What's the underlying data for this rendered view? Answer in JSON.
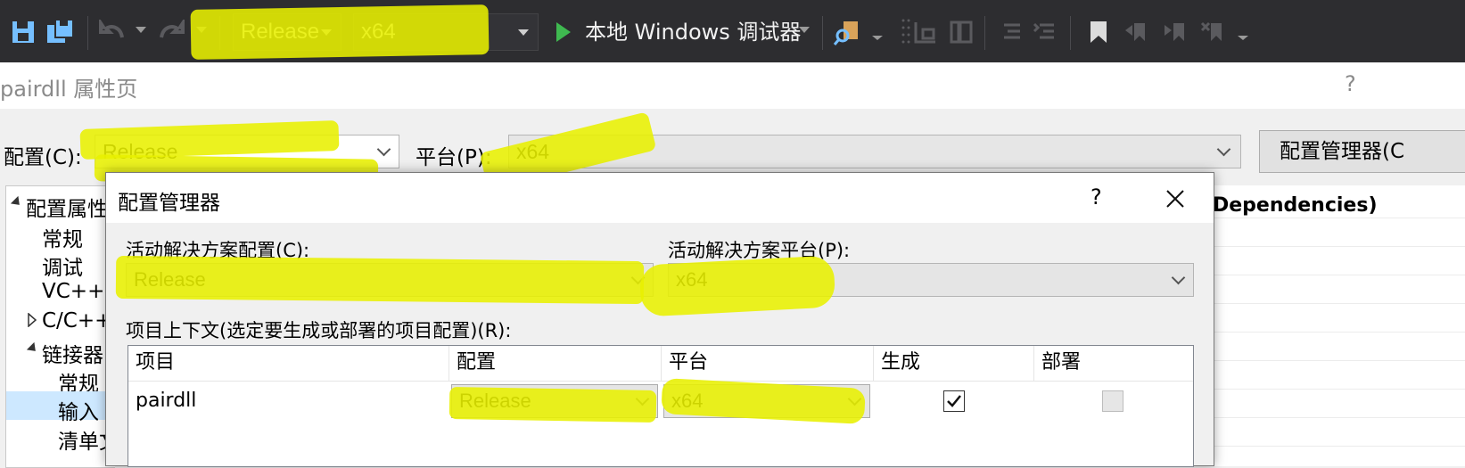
{
  "toolbar": {
    "configuration": "Release",
    "platform": "x64",
    "run_label": "本地 Windows 调试器"
  },
  "window": {
    "title": "pairdll 属性页",
    "help": "?"
  },
  "config_row": {
    "config_label": "配置(C):",
    "config_value": "Release",
    "platform_label": "平台(P):",
    "platform_value": "x64",
    "manager_button": "配置管理器(C"
  },
  "tree": {
    "items": [
      {
        "label": "配置属性"
      },
      {
        "label": "常规"
      },
      {
        "label": "调试"
      },
      {
        "label": "VC++"
      },
      {
        "label": "C/C++"
      },
      {
        "label": "链接器"
      },
      {
        "label": "常规"
      },
      {
        "label": "输入"
      },
      {
        "label": "清单文"
      }
    ]
  },
  "grid": {
    "header": "Dependencies)"
  },
  "dialog": {
    "title": "配置管理器",
    "help": "?",
    "active_config_label": "活动解决方案配置(C):",
    "active_config_value": "Release",
    "active_platform_label": "活动解决方案平台(P):",
    "active_platform_value": "x64",
    "context_label": "项目上下文(选定要生成或部署的项目配置)(R):",
    "table": {
      "headers": [
        "项目",
        "配置",
        "平台",
        "生成",
        "部署"
      ],
      "rows": [
        {
          "project": "pairdll",
          "configuration": "Release",
          "platform": "x64",
          "build": true,
          "deploy": false
        }
      ]
    }
  },
  "colors": {
    "toolbar_bg": "#2d2d30",
    "highlight": "#e8f000",
    "run_icon": "#3fb950",
    "save_icon": "#75bfff"
  }
}
